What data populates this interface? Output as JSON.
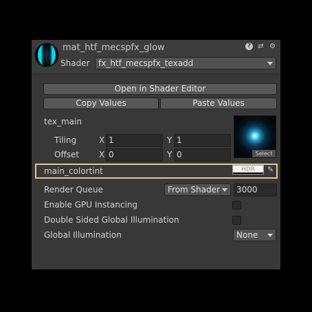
{
  "material": {
    "name": "mat_htf_mecspfx_glow",
    "shader_label": "Shader",
    "shader_value": "fx_htf_mecspfx_texadd"
  },
  "header_icons": [
    "help-icon",
    "preset-icon",
    "settings-icon"
  ],
  "buttons": {
    "open_shader_editor": "Open in Shader Editor",
    "copy_values": "Copy Values",
    "paste_values": "Paste Values"
  },
  "tex_main": {
    "label": "tex_main",
    "tiling_label": "Tiling",
    "offset_label": "Offset",
    "x_label": "X",
    "y_label": "Y",
    "tiling_x": "1",
    "tiling_y": "1",
    "offset_x": "0",
    "offset_y": "0",
    "select_label": "Select"
  },
  "colortint": {
    "label": "main_colortint",
    "hdr_label": "HDR",
    "color": "#f6f6f6"
  },
  "render_queue": {
    "label": "Render Queue",
    "mode": "From Shader",
    "value": "3000"
  },
  "gpu_instancing": {
    "label": "Enable GPU Instancing",
    "checked": false
  },
  "double_sided_gi": {
    "label": "Double Sided Global Illumination",
    "checked": false
  },
  "global_illumination": {
    "label": "Global Illumination",
    "value": "None"
  },
  "colors": {
    "highlight": "#e8c98a",
    "material_glow": "#00e5ff",
    "panel_bg": "#383838"
  }
}
